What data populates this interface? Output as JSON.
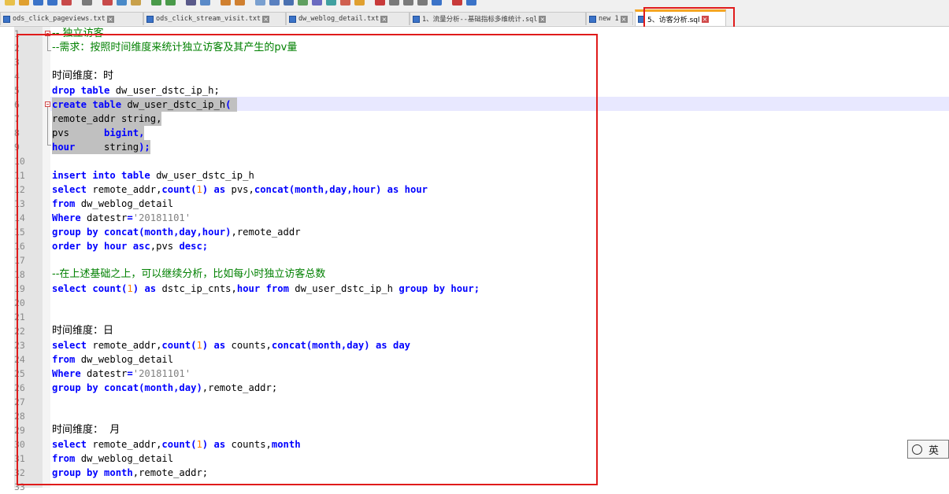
{
  "tabs": [
    {
      "label": "ods_click_pageviews.txt",
      "active": false
    },
    {
      "label": "ods_click_stream_visit.txt",
      "active": false
    },
    {
      "label": "dw_weblog_detail.txt",
      "active": false
    },
    {
      "label": "1、流量分析--基础指标多维统计.sql",
      "active": false
    },
    {
      "label": "new 1",
      "active": false
    },
    {
      "label": "5、访客分析.sql",
      "active": true
    }
  ],
  "tab_close_glyph": "×",
  "ime": {
    "label": "英",
    "icon": "ime-status-icon"
  },
  "colors": {
    "keyword": "#0000ff",
    "comment": "#008000",
    "string": "#808080",
    "number": "#ff8000",
    "annotation": "#e01b1b"
  },
  "code": {
    "line_numbers": [
      "1",
      "2",
      "3",
      "4",
      "5",
      "6",
      "7",
      "8",
      "9",
      "10",
      "11",
      "12",
      "13",
      "14",
      "15",
      "16",
      "17",
      "18",
      "19",
      "20",
      "21",
      "22",
      "23",
      "24",
      "25",
      "26",
      "27",
      "28",
      "29",
      "30",
      "31",
      "32",
      "33"
    ],
    "l1": {
      "text": "-- 独立访客"
    },
    "l2": {
      "text": "--需求：按照时间维度来统计独立访客及其产生的pv量"
    },
    "l4": {
      "text": "时间维度：时"
    },
    "l5": {
      "kw1": "drop table",
      "t1": " dw_user_dstc_ip_h;"
    },
    "l6": {
      "kw1": "create table",
      "t1": " dw_user_dstc_ip_h",
      "p1": "( "
    },
    "l7": {
      "t1": "remote_addr string,"
    },
    "l8": {
      "t1": "pvs      ",
      "kw1": "bigint",
      "t2": ","
    },
    "l9": {
      "kw1": "hour",
      "t1": "     string",
      "kw2": ");"
    },
    "l11": {
      "kw1": "insert into table",
      "t1": " dw_user_dstc_ip_h"
    },
    "l12": {
      "kw1": "select",
      "t1": " remote_addr,",
      "kw2": "count(",
      "n1": "1",
      "kw3": ")",
      "t2": " ",
      "kw4": "as",
      "t3": " pvs,",
      "kw5": "concat(month,day,hour)",
      "t4": " ",
      "kw6": "as",
      "t5": " ",
      "kw7": "hour"
    },
    "l13": {
      "kw1": "from",
      "t1": " dw_weblog_detail"
    },
    "l14": {
      "kw1": "Where",
      "t1": " datestr",
      "kw2": "=",
      "s1": "'20181101'"
    },
    "l15": {
      "kw1": "group by",
      "t1": " ",
      "kw2": "concat(month,day,hour)",
      "t2": ",remote_addr"
    },
    "l16": {
      "kw1": "order by",
      "t1": " ",
      "kw2": "hour",
      "t2": " ",
      "kw3": "asc",
      "t3": ",pvs ",
      "kw4": "desc;"
    },
    "l18": {
      "text": "--在上述基础之上，可以继续分析，比如每小时独立访客总数"
    },
    "l19": {
      "kw1": "select",
      "t1": " ",
      "kw2": "count(",
      "n1": "1",
      "kw3": ")",
      "t2": " ",
      "kw4": "as",
      "t3": " dstc_ip_cnts,",
      "kw5": "hour",
      "t4": " ",
      "kw6": "from",
      "t5": " dw_user_dstc_ip_h ",
      "kw7": "group by",
      "t6": " ",
      "kw8": "hour;"
    },
    "l22": {
      "text": "时间维度：日"
    },
    "l23": {
      "kw1": "select",
      "t1": " remote_addr,",
      "kw2": "count(",
      "n1": "1",
      "kw3": ")",
      "t2": " ",
      "kw4": "as",
      "t3": " counts,",
      "kw5": "concat(month,day)",
      "t4": " ",
      "kw6": "as",
      "t5": " ",
      "kw7": "day"
    },
    "l24": {
      "kw1": "from",
      "t1": " dw_weblog_detail"
    },
    "l25": {
      "kw1": "Where",
      "t1": " datestr",
      "kw2": "=",
      "s1": "'20181101'"
    },
    "l26": {
      "kw1": "group by",
      "t1": " ",
      "kw2": "concat(month,day)",
      "t2": ",remote_addr;"
    },
    "l29": {
      "text": "时间维度：  月"
    },
    "l30": {
      "kw1": "select",
      "t1": " remote_addr,",
      "kw2": "count(",
      "n1": "1",
      "kw3": ")",
      "t2": " ",
      "kw4": "as",
      "t3": " counts,",
      "kw5": "month"
    },
    "l31": {
      "kw1": "from",
      "t1": " dw_weblog_detail"
    },
    "l32": {
      "kw1": "group by",
      "t1": " ",
      "kw2": "month",
      "t2": ",remote_addr;"
    }
  }
}
